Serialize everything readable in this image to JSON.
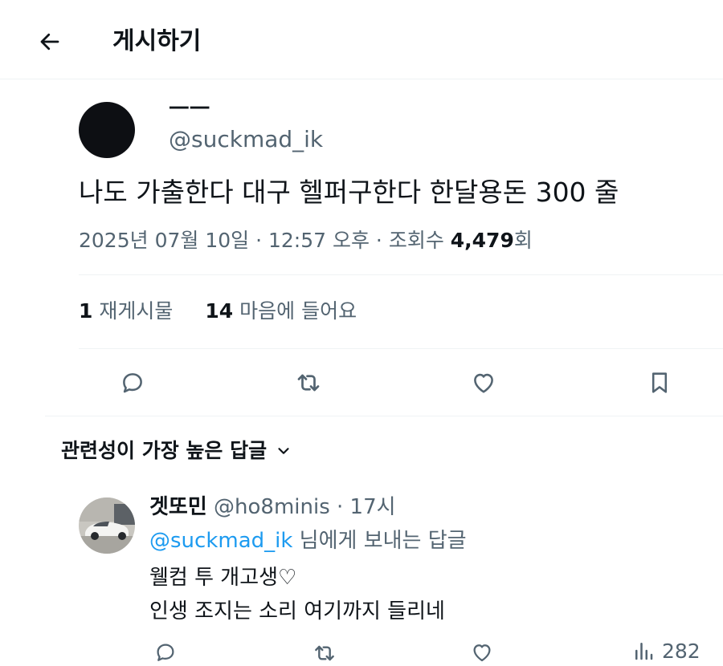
{
  "header": {
    "back_icon": "arrow-left-icon",
    "title": "게시하기"
  },
  "post": {
    "display_name": "ㅡㅡ",
    "handle": "@suckmad_ik",
    "text": "나도 가출한다 대구 헬퍼구한다 한달용돈 300 줄",
    "timestamp": "2025년 07월 10일 · 12:57 오후 · 조회수 ",
    "views": "4,479",
    "views_suffix": "회",
    "stats": {
      "reposts_count": "1",
      "reposts_label": "재게시물",
      "likes_count": "14",
      "likes_label": "마음에 들어요"
    },
    "actions": [
      "reply-icon",
      "repost-icon",
      "like-icon",
      "bookmark-icon"
    ]
  },
  "replies_sort": {
    "label": "관련성이 가장 높은 답글",
    "icon": "chevron-down-icon"
  },
  "reply": {
    "display_name": "겟또민",
    "handle": "@ho8minis",
    "time": " · 17시",
    "reply_to_handle": "@suckmad_ik",
    "reply_to_suffix": " 님에게 보내는 답글",
    "line1": "웰컴 투 개고생♡",
    "line2": "인생 조지는 소리 여기까지 들리네",
    "views": "282"
  },
  "colors": {
    "text": "#0f1419",
    "secondary": "#536471",
    "accent": "#1d9bf0",
    "divider": "#eff3f4"
  }
}
